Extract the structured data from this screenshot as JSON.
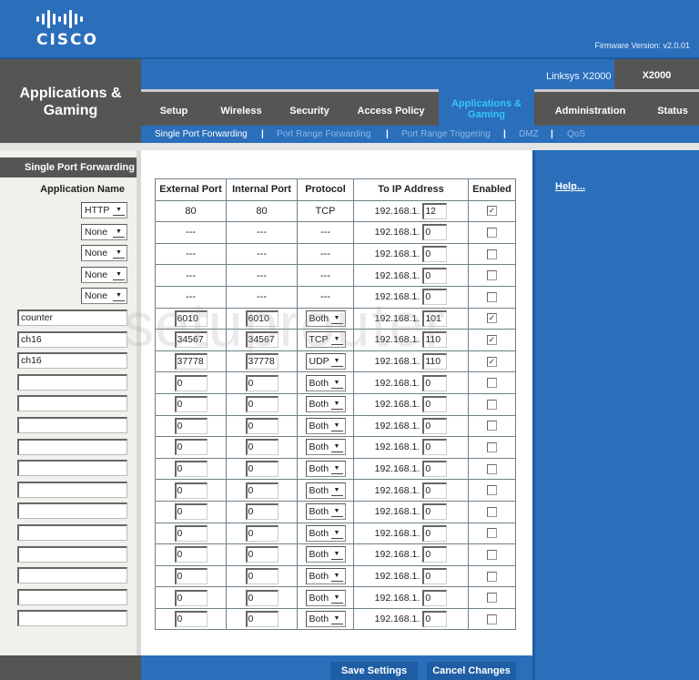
{
  "header": {
    "brand": "CISCO",
    "firmware": "Firmware Version: v2.0.01",
    "section_title": "Applications & Gaming",
    "model_name": "Linksys X2000",
    "model_short": "X2000"
  },
  "nav": {
    "tabs": [
      {
        "label": "Setup",
        "active": false
      },
      {
        "label": "Wireless",
        "active": false
      },
      {
        "label": "Security",
        "active": false
      },
      {
        "label": "Access Policy",
        "active": false
      },
      {
        "label": "Applications & Gaming",
        "active": true
      },
      {
        "label": "Administration",
        "active": false
      },
      {
        "label": "Status",
        "active": false
      }
    ],
    "subtabs": [
      {
        "label": "Single Port Forwarding",
        "active": true
      },
      {
        "label": "Port Range Forwarding",
        "active": false
      },
      {
        "label": "Port Range Triggering",
        "active": false
      },
      {
        "label": "DMZ",
        "active": false
      },
      {
        "label": "QoS",
        "active": false
      }
    ],
    "separator": "|"
  },
  "sidebar": {
    "title": "Single Port Forwarding",
    "app_name_header": "Application Name"
  },
  "table": {
    "columns": [
      "External Port",
      "Internal Port",
      "Protocol",
      "To IP Address",
      "Enabled"
    ],
    "ip_prefix": "192.168.1.",
    "rows": [
      {
        "app": "HTTP",
        "app_type": "select",
        "ext": "80",
        "int": "80",
        "proto": "TCP",
        "editable": false,
        "ip": "12",
        "enabled": true
      },
      {
        "app": "None",
        "app_type": "select",
        "ext": "---",
        "int": "---",
        "proto": "---",
        "editable": false,
        "ip": "0",
        "enabled": false
      },
      {
        "app": "None",
        "app_type": "select",
        "ext": "---",
        "int": "---",
        "proto": "---",
        "editable": false,
        "ip": "0",
        "enabled": false
      },
      {
        "app": "None",
        "app_type": "select",
        "ext": "---",
        "int": "---",
        "proto": "---",
        "editable": false,
        "ip": "0",
        "enabled": false
      },
      {
        "app": "None",
        "app_type": "select",
        "ext": "---",
        "int": "---",
        "proto": "---",
        "editable": false,
        "ip": "0",
        "enabled": false
      },
      {
        "app": "counter",
        "app_type": "input",
        "ext": "6010",
        "int": "6010",
        "proto": "Both",
        "editable": true,
        "ip": "101",
        "enabled": true
      },
      {
        "app": "ch16",
        "app_type": "input",
        "ext": "34567",
        "int": "34567",
        "proto": "TCP",
        "editable": true,
        "ip": "110",
        "enabled": true
      },
      {
        "app": "ch16",
        "app_type": "input",
        "ext": "37778",
        "int": "37778",
        "proto": "UDP",
        "editable": true,
        "ip": "110",
        "enabled": true
      },
      {
        "app": "",
        "app_type": "input",
        "ext": "0",
        "int": "0",
        "proto": "Both",
        "editable": true,
        "ip": "0",
        "enabled": false
      },
      {
        "app": "",
        "app_type": "input",
        "ext": "0",
        "int": "0",
        "proto": "Both",
        "editable": true,
        "ip": "0",
        "enabled": false
      },
      {
        "app": "",
        "app_type": "input",
        "ext": "0",
        "int": "0",
        "proto": "Both",
        "editable": true,
        "ip": "0",
        "enabled": false
      },
      {
        "app": "",
        "app_type": "input",
        "ext": "0",
        "int": "0",
        "proto": "Both",
        "editable": true,
        "ip": "0",
        "enabled": false
      },
      {
        "app": "",
        "app_type": "input",
        "ext": "0",
        "int": "0",
        "proto": "Both",
        "editable": true,
        "ip": "0",
        "enabled": false
      },
      {
        "app": "",
        "app_type": "input",
        "ext": "0",
        "int": "0",
        "proto": "Both",
        "editable": true,
        "ip": "0",
        "enabled": false
      },
      {
        "app": "",
        "app_type": "input",
        "ext": "0",
        "int": "0",
        "proto": "Both",
        "editable": true,
        "ip": "0",
        "enabled": false
      },
      {
        "app": "",
        "app_type": "input",
        "ext": "0",
        "int": "0",
        "proto": "Both",
        "editable": true,
        "ip": "0",
        "enabled": false
      },
      {
        "app": "",
        "app_type": "input",
        "ext": "0",
        "int": "0",
        "proto": "Both",
        "editable": true,
        "ip": "0",
        "enabled": false
      },
      {
        "app": "",
        "app_type": "input",
        "ext": "0",
        "int": "0",
        "proto": "Both",
        "editable": true,
        "ip": "0",
        "enabled": false
      },
      {
        "app": "",
        "app_type": "input",
        "ext": "0",
        "int": "0",
        "proto": "Both",
        "editable": true,
        "ip": "0",
        "enabled": false
      },
      {
        "app": "",
        "app_type": "input",
        "ext": "0",
        "int": "0",
        "proto": "Both",
        "editable": true,
        "ip": "0",
        "enabled": false
      }
    ]
  },
  "help": {
    "link": "Help..."
  },
  "footer": {
    "save": "Save Settings",
    "cancel": "Cancel Changes"
  },
  "watermark": "setuprouter",
  "colors": {
    "brand_blue": "#2b6fbb",
    "dark_gray": "#555553",
    "active_tab_text": "#35c6f4"
  }
}
